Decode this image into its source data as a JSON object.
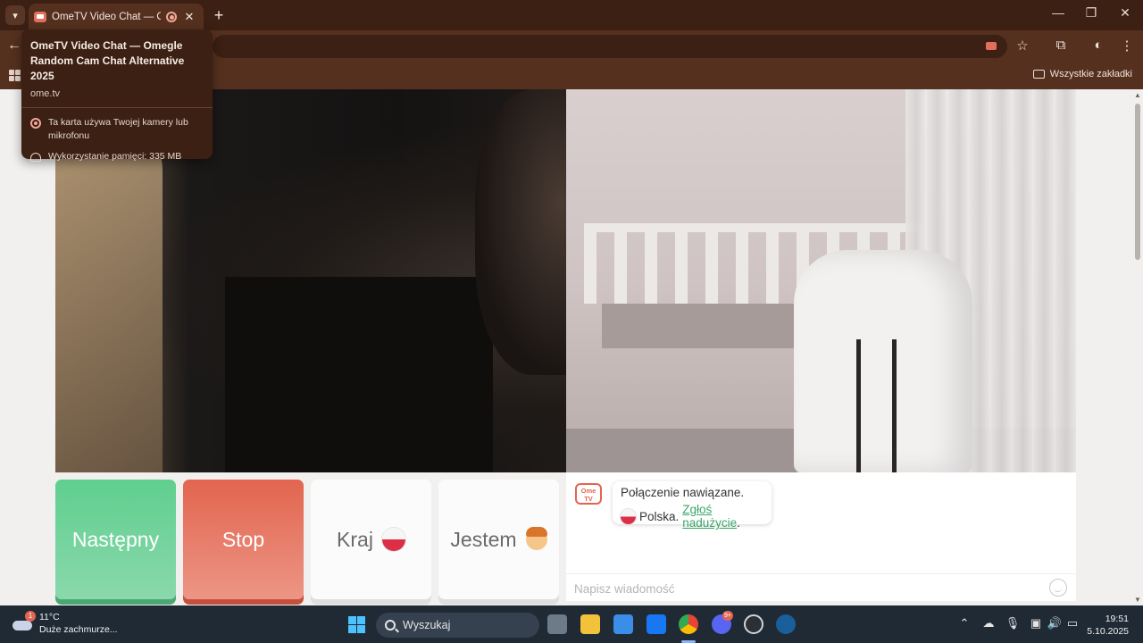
{
  "browser": {
    "tab": {
      "title": "OmeTV Video Chat — Omegle Random Cam Chat Alternative 2025"
    },
    "bookmarks": {
      "all_label": "Wszystkie zakładki"
    }
  },
  "tooltip": {
    "title": "OmeTV Video Chat — Omegle Random Cam Chat Alternative 2025",
    "url": "ome.tv",
    "camera_notice": "Ta karta używa Twojej kamery lub mikrofonu",
    "memory": "Wykorzystanie pamięci: 335 MB"
  },
  "controls": {
    "next_label": "Następny",
    "stop_label": "Stop",
    "country_label": "Kraj",
    "gender_label": "Jestem"
  },
  "chat": {
    "logo_text": "Ome TV",
    "status": "Połączenie nawiązane.",
    "country": "Polska.",
    "report_link": "Zgłoś nadużycie",
    "report_suffix": ".",
    "input_placeholder": "Napisz wiadomość"
  },
  "taskbar": {
    "weather": {
      "temp": "11°C",
      "condition": "Duże zachmurze...",
      "badge": "1"
    },
    "search_label": "Wyszukaj",
    "discord_badge": "9+",
    "clock": {
      "time": "19:51",
      "date": "5.10.2025"
    }
  },
  "colors": {
    "accent_green": "#5fcf8e",
    "accent_red": "#e2654f",
    "browser_frame": "#55301f"
  }
}
